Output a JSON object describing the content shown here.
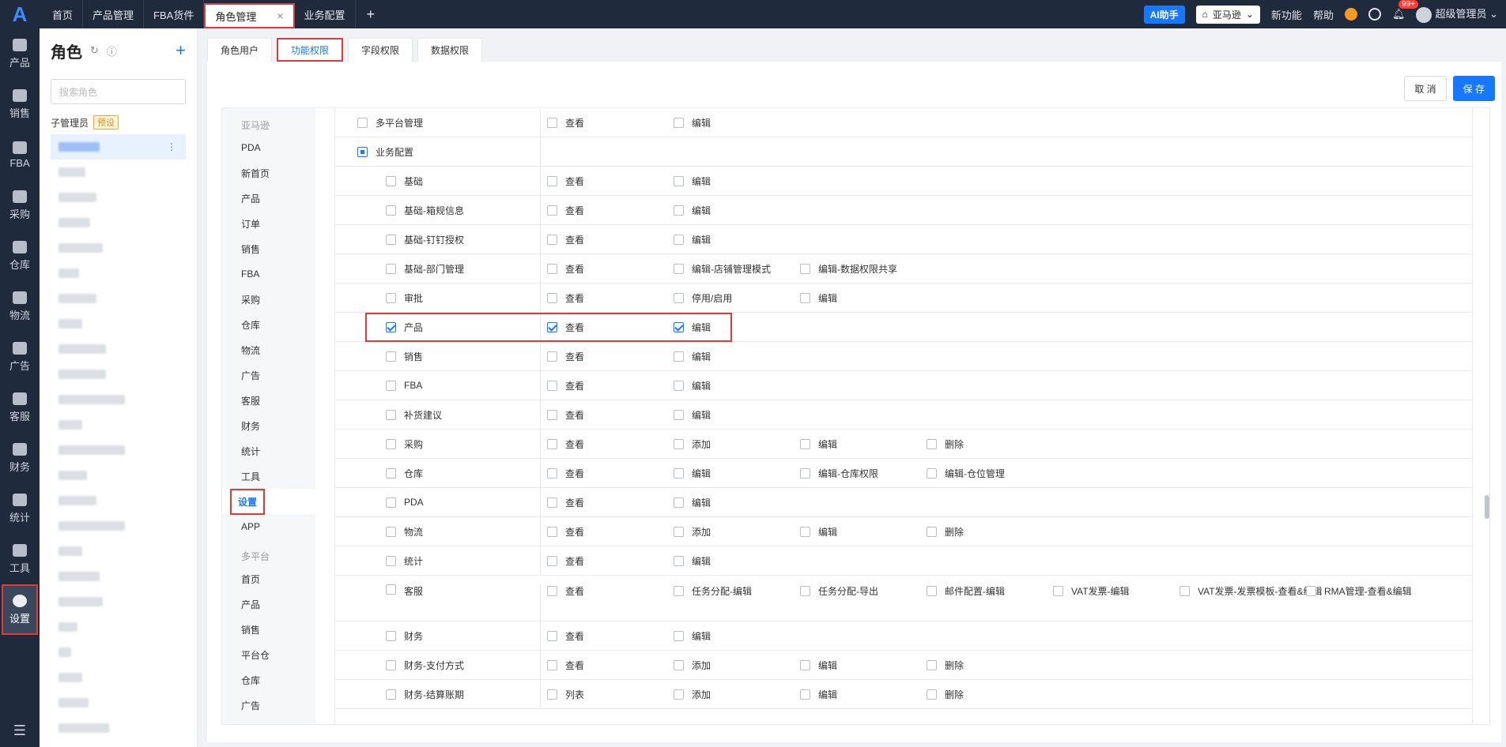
{
  "rail": {
    "logo": "A",
    "items": [
      "产品",
      "销售",
      "FBA",
      "采购",
      "仓库",
      "物流",
      "广告",
      "客服",
      "财务",
      "统计",
      "工具",
      "设置"
    ],
    "active": "设置"
  },
  "topbar": {
    "tabs": [
      "首页",
      "产品管理",
      "FBA货件",
      "角色管理",
      "业务配置"
    ],
    "active_tab": "角色管理",
    "close": "×",
    "plus": "+",
    "ai": "AI助手",
    "site": "亚马逊",
    "new_feature": "新功能",
    "help": "帮助",
    "badge": "99+",
    "user": "超级管理员"
  },
  "roles": {
    "title": "角色",
    "search_placeholder": "搜索角色",
    "group": "子管理员",
    "preset": "预设",
    "more": "⋮",
    "items": [
      52,
      34,
      48,
      40,
      56,
      26,
      48,
      30,
      60,
      60,
      84,
      30,
      84,
      36,
      48,
      84,
      30,
      52,
      56,
      24,
      16,
      30,
      38,
      64
    ]
  },
  "subtabs": [
    "角色用户",
    "功能权限",
    "字段权限",
    "数据权限"
  ],
  "active_subtab": "功能权限",
  "buttons": {
    "cancel": "取 消",
    "save": "保 存"
  },
  "categories": {
    "amazon_head": "亚马逊",
    "amazon": [
      "PDA",
      "新首页",
      "产品",
      "订单",
      "销售",
      "FBA",
      "采购",
      "仓库",
      "物流",
      "广告",
      "客服",
      "财务",
      "统计",
      "工具",
      "设置",
      "APP"
    ],
    "active": "设置",
    "multi_head": "多平台",
    "multi": [
      "首页",
      "产品",
      "销售",
      "平台仓",
      "仓库",
      "广告"
    ]
  },
  "rows": [
    {
      "name": "多平台管理",
      "level": 1,
      "state": "off",
      "perms": [
        [
          "查看",
          false
        ],
        [
          "编辑",
          false
        ]
      ]
    },
    {
      "name": "业务配置",
      "level": 1,
      "state": "part",
      "perms": []
    },
    {
      "name": "基础",
      "level": 2,
      "state": "off",
      "perms": [
        [
          "查看",
          false
        ],
        [
          "编辑",
          false
        ]
      ]
    },
    {
      "name": "基础-箱规信息",
      "level": 2,
      "state": "off",
      "perms": [
        [
          "查看",
          false
        ],
        [
          "编辑",
          false
        ]
      ]
    },
    {
      "name": "基础-钉钉授权",
      "level": 2,
      "state": "off",
      "perms": [
        [
          "查看",
          false
        ],
        [
          "编辑",
          false
        ]
      ]
    },
    {
      "name": "基础-部门管理",
      "level": 2,
      "state": "off",
      "perms": [
        [
          "查看",
          false
        ],
        [
          "编辑-店铺管理模式",
          false
        ],
        [
          "编辑-数据权限共享",
          false
        ]
      ]
    },
    {
      "name": "审批",
      "level": 2,
      "state": "off",
      "perms": [
        [
          "查看",
          false
        ],
        [
          "停用/启用",
          false
        ],
        [
          "编辑",
          false
        ]
      ]
    },
    {
      "name": "产品",
      "level": 2,
      "state": "on",
      "highlight": true,
      "perms": [
        [
          "查看",
          true
        ],
        [
          "编辑",
          true
        ]
      ]
    },
    {
      "name": "销售",
      "level": 2,
      "state": "off",
      "perms": [
        [
          "查看",
          false
        ],
        [
          "编辑",
          false
        ]
      ]
    },
    {
      "name": "FBA",
      "level": 2,
      "state": "off",
      "perms": [
        [
          "查看",
          false
        ],
        [
          "编辑",
          false
        ]
      ]
    },
    {
      "name": "补货建议",
      "level": 2,
      "state": "off",
      "perms": [
        [
          "查看",
          false
        ],
        [
          "编辑",
          false
        ]
      ]
    },
    {
      "name": "采购",
      "level": 2,
      "state": "off",
      "perms": [
        [
          "查看",
          false
        ],
        [
          "添加",
          false
        ],
        [
          "编辑",
          false
        ],
        [
          "删除",
          false
        ]
      ]
    },
    {
      "name": "仓库",
      "level": 2,
      "state": "off",
      "perms": [
        [
          "查看",
          false
        ],
        [
          "编辑",
          false
        ],
        [
          "编辑-仓库权限",
          false
        ],
        [
          "编辑-仓位管理",
          false
        ]
      ]
    },
    {
      "name": "PDA",
      "level": 2,
      "state": "off",
      "perms": [
        [
          "查看",
          false
        ],
        [
          "编辑",
          false
        ]
      ]
    },
    {
      "name": "物流",
      "level": 2,
      "state": "off",
      "perms": [
        [
          "查看",
          false
        ],
        [
          "添加",
          false
        ],
        [
          "编辑",
          false
        ],
        [
          "删除",
          false
        ]
      ]
    },
    {
      "name": "统计",
      "level": 2,
      "state": "off",
      "perms": [
        [
          "查看",
          false
        ],
        [
          "编辑",
          false
        ]
      ]
    },
    {
      "name": "客服",
      "level": 2,
      "state": "off",
      "tall": true,
      "perms": [
        [
          "查看",
          false
        ],
        [
          "任务分配-编辑",
          false
        ],
        [
          "任务分配-导出",
          false
        ],
        [
          "邮件配置-编辑",
          false
        ],
        [
          "VAT发票-编辑",
          false
        ],
        [
          "VAT发票-发票模板-查看&编辑",
          false
        ],
        [
          "RMA管理-查看&编辑",
          false
        ]
      ]
    },
    {
      "name": "财务",
      "level": 2,
      "state": "off",
      "perms": [
        [
          "查看",
          false
        ],
        [
          "编辑",
          false
        ]
      ]
    },
    {
      "name": "财务-支付方式",
      "level": 2,
      "state": "off",
      "perms": [
        [
          "查看",
          false
        ],
        [
          "添加",
          false
        ],
        [
          "编辑",
          false
        ],
        [
          "删除",
          false
        ]
      ]
    },
    {
      "name": "财务-结算账期",
      "level": 2,
      "state": "off",
      "perms": [
        [
          "列表",
          false
        ],
        [
          "添加",
          false
        ],
        [
          "编辑",
          false
        ],
        [
          "删除",
          false
        ]
      ]
    }
  ]
}
